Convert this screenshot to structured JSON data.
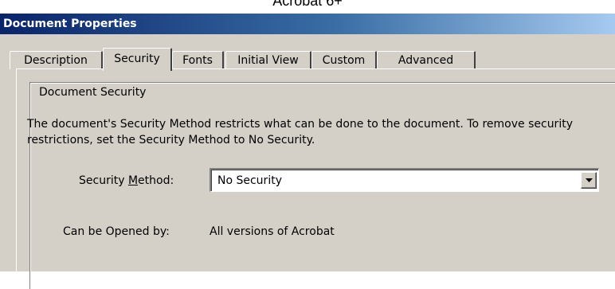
{
  "caption": "Acrobat 6+",
  "window": {
    "title": "Document Properties"
  },
  "tabs": [
    {
      "label": "Description",
      "active": false
    },
    {
      "label": "Security",
      "active": true
    },
    {
      "label": "Fonts",
      "active": false
    },
    {
      "label": "Initial View",
      "active": false
    },
    {
      "label": "Custom",
      "active": false
    },
    {
      "label": "Advanced",
      "active": false
    }
  ],
  "security": {
    "group_title": "Document Security",
    "description_line1": "The document's Security Method restricts what can be done to the document. To remove security",
    "description_line2": "restrictions, set the Security Method to No Security.",
    "method_label_prefix": "Security ",
    "method_label_accel": "M",
    "method_label_suffix": "ethod:",
    "method_value": "No Security",
    "opened_by_label": "Can be Opened by:",
    "opened_by_value": "All versions of Acrobat"
  },
  "icons": {
    "dropdown": "chevron-down-icon"
  },
  "colors": {
    "dialog_bg": "#d4d0c8",
    "title_start": "#0a246a",
    "title_end": "#a6caf0"
  }
}
